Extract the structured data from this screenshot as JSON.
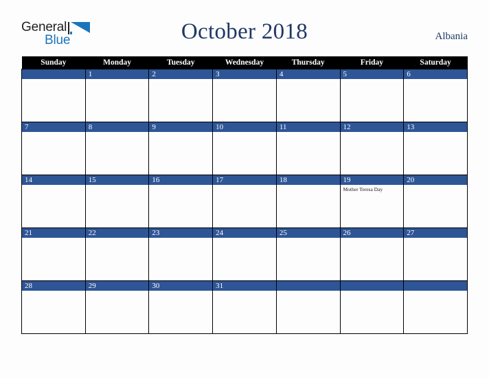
{
  "brand": {
    "name_part1": "General",
    "name_part2": "Blue"
  },
  "header": {
    "title": "October 2018",
    "location": "Albania"
  },
  "colors": {
    "header_row_bg": "#000000",
    "date_bar_bg": "#2e5596",
    "title_text": "#1f3864",
    "brand_blue": "#1b75bc",
    "page_bg": "#fdfdfd"
  },
  "calendar": {
    "weekday_headers": [
      "Sunday",
      "Monday",
      "Tuesday",
      "Wednesday",
      "Thursday",
      "Friday",
      "Saturday"
    ],
    "weeks": [
      [
        {
          "date": "",
          "events": []
        },
        {
          "date": "1",
          "events": []
        },
        {
          "date": "2",
          "events": []
        },
        {
          "date": "3",
          "events": []
        },
        {
          "date": "4",
          "events": []
        },
        {
          "date": "5",
          "events": []
        },
        {
          "date": "6",
          "events": []
        }
      ],
      [
        {
          "date": "7",
          "events": []
        },
        {
          "date": "8",
          "events": []
        },
        {
          "date": "9",
          "events": []
        },
        {
          "date": "10",
          "events": []
        },
        {
          "date": "11",
          "events": []
        },
        {
          "date": "12",
          "events": []
        },
        {
          "date": "13",
          "events": []
        }
      ],
      [
        {
          "date": "14",
          "events": []
        },
        {
          "date": "15",
          "events": []
        },
        {
          "date": "16",
          "events": []
        },
        {
          "date": "17",
          "events": []
        },
        {
          "date": "18",
          "events": []
        },
        {
          "date": "19",
          "events": [
            "Mother Teresa Day"
          ]
        },
        {
          "date": "20",
          "events": []
        }
      ],
      [
        {
          "date": "21",
          "events": []
        },
        {
          "date": "22",
          "events": []
        },
        {
          "date": "23",
          "events": []
        },
        {
          "date": "24",
          "events": []
        },
        {
          "date": "25",
          "events": []
        },
        {
          "date": "26",
          "events": []
        },
        {
          "date": "27",
          "events": []
        }
      ],
      [
        {
          "date": "28",
          "events": []
        },
        {
          "date": "29",
          "events": []
        },
        {
          "date": "30",
          "events": []
        },
        {
          "date": "31",
          "events": []
        },
        {
          "date": "",
          "events": []
        },
        {
          "date": "",
          "events": []
        },
        {
          "date": "",
          "events": []
        }
      ]
    ]
  }
}
